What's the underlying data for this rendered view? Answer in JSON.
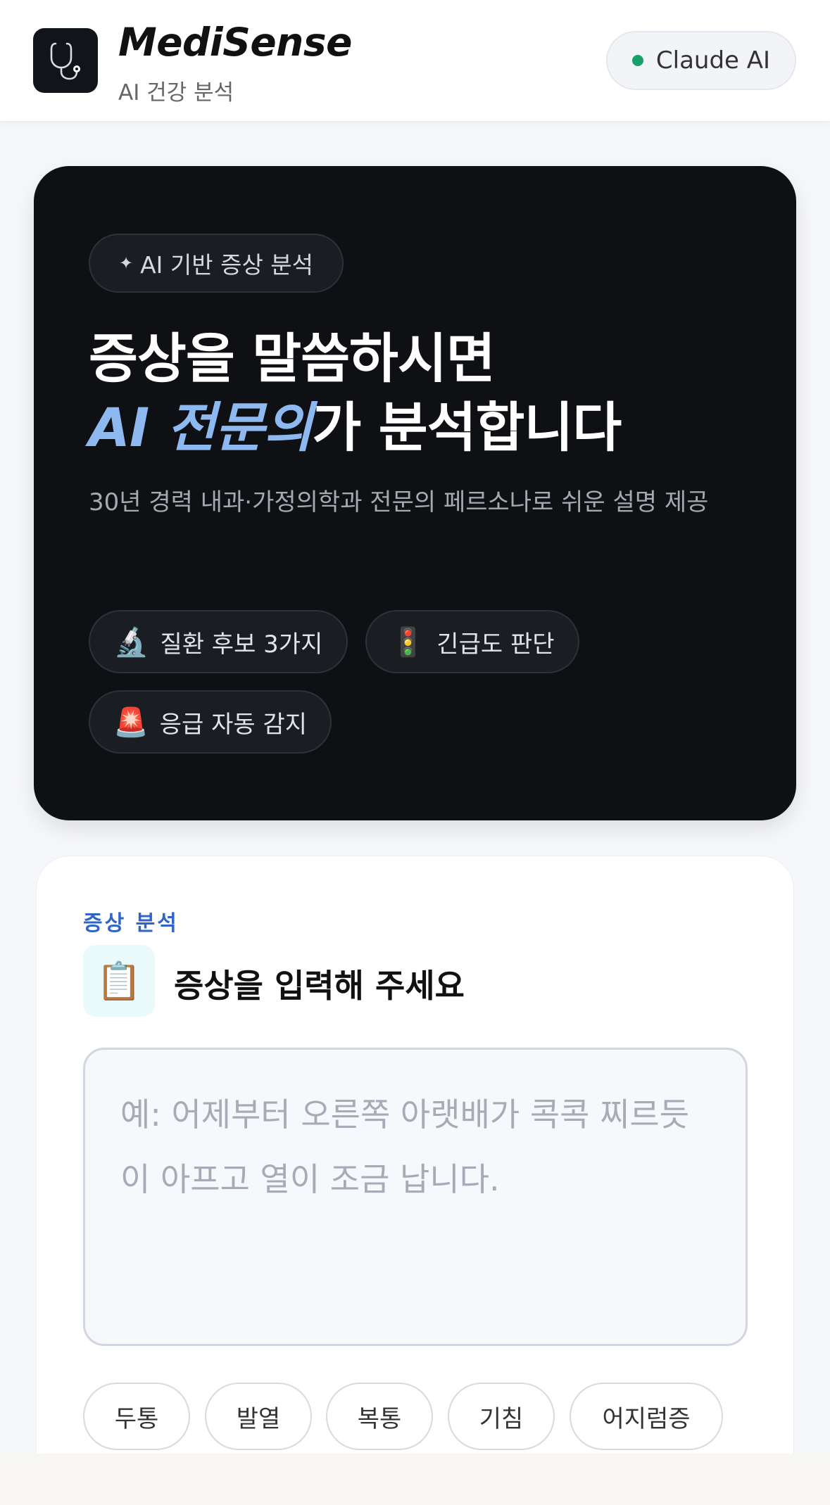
{
  "header": {
    "title": "MediSense",
    "subtitle": "AI 건강 분석",
    "badge": "Claude AI",
    "logo_icon": "stethoscope-icon"
  },
  "hero": {
    "pill": "AI 기반 증상 분석",
    "pill_icon": "✦",
    "title_line1": "증상을 말씀하시면",
    "title_accent": "AI 전문의",
    "title_rest": "가 분석합니다",
    "description": "30년 경력 내과·가정의학과 전문의 페르소나로 쉬운 설명 제공",
    "features": [
      {
        "icon": "🔬",
        "label": "질환 후보 3가지"
      },
      {
        "icon": "🚦",
        "label": "긴급도 판단"
      },
      {
        "icon": "🚨",
        "label": "응급 자동 감지"
      }
    ]
  },
  "symptom": {
    "eyebrow": "증상 분석",
    "icon": "📋",
    "title": "증상을 입력해 주세요",
    "placeholder": "예: 어제부터 오른쪽 아랫배가 콕콕 찌르듯이 아프고 열이 조금 납니다.",
    "chips": [
      "두통",
      "발열",
      "복통",
      "기침",
      "어지럼증"
    ]
  },
  "colors": {
    "accent": "#8db9f0",
    "eyebrow": "#2f64c8",
    "status_dot": "#18a06a",
    "hero_bg": "#0e1014"
  }
}
